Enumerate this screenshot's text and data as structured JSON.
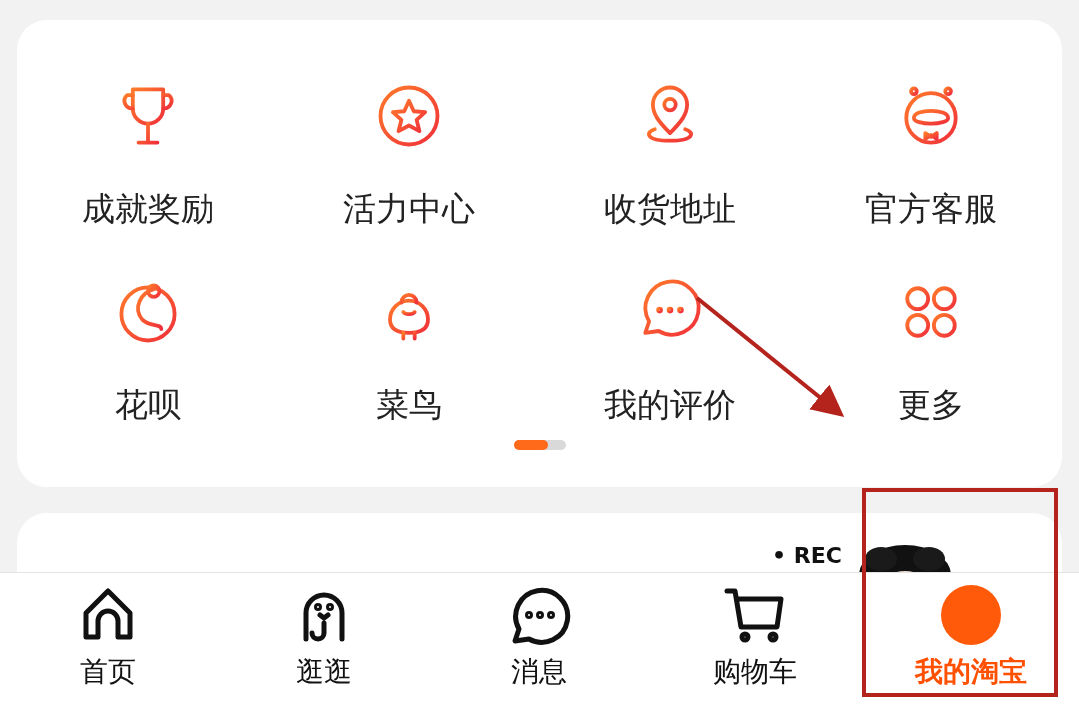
{
  "grid": {
    "items": [
      {
        "label": "成就奖励"
      },
      {
        "label": "活力中心"
      },
      {
        "label": "收货地址"
      },
      {
        "label": "官方客服"
      },
      {
        "label": "花呗"
      },
      {
        "label": "菜鸟"
      },
      {
        "label": "我的评价"
      },
      {
        "label": "更多"
      }
    ]
  },
  "feed_card": {
    "badge": "• REC"
  },
  "tab_bar": [
    {
      "label": "首页",
      "selected": false
    },
    {
      "label": "逛逛",
      "selected": false
    },
    {
      "label": "消息",
      "selected": false
    },
    {
      "label": "购物车",
      "selected": false
    },
    {
      "label": "我的淘宝",
      "selected": true
    }
  ]
}
